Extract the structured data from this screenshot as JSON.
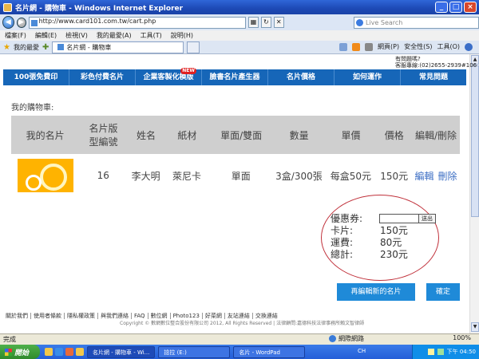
{
  "window": {
    "title": "名片網 - 購物車 - Windows Internet Explorer",
    "controls": [
      "_",
      "□",
      "×"
    ]
  },
  "browser": {
    "url": "http://www.card101.com.tw/cart.php",
    "search_placeholder": "Live Search",
    "menu": [
      "檔案(F)",
      "編輯(E)",
      "檢視(V)",
      "我的最愛(A)",
      "工具(T)",
      "說明(H)"
    ],
    "favorites_label": "我的最愛",
    "tab_label": "名片網 - 購物車",
    "toolbar": [
      "網頁(P)",
      "安全性(S)",
      "工具(O)"
    ]
  },
  "site": {
    "help_line1": "有問題嗎?",
    "help_line2": "客服專線:(02)2655-2939#106",
    "nav": [
      {
        "label": "100張免費印"
      },
      {
        "label": "彩色付費名片"
      },
      {
        "label": "企業客製化模版",
        "badge": "NEW"
      },
      {
        "label": "臉書名片產生器"
      },
      {
        "label": "名片價格"
      },
      {
        "label": "如何運作"
      },
      {
        "label": "常見問題"
      }
    ]
  },
  "cart": {
    "title": "我的購物車:",
    "headers": [
      "我的名片",
      "名片版型編號",
      "姓名",
      "紙材",
      "單面/雙面",
      "數量",
      "單價",
      "價格",
      "編輯/刪除"
    ],
    "row": {
      "template_no": "16",
      "name": "李大明",
      "paper": "萊尼卡",
      "sides": "單面",
      "quantity": "3盒/300張",
      "unit_price": "每盒50元",
      "price": "150元",
      "edit": "編輯",
      "delete": "刪除"
    },
    "summary": {
      "coupon_label": "優惠券:",
      "coupon_button": "送出",
      "card_label": "卡片:",
      "card_value": "150元",
      "shipping_label": "運費:",
      "shipping_value": "80元",
      "total_label": "總計:",
      "total_value": "230元"
    },
    "buttons": {
      "reedit": "再編輯新的名片",
      "confirm": "確定"
    }
  },
  "footer": {
    "links": [
      "關於我們",
      "使用者條款",
      "隱私權政策",
      "與我們連絡",
      "FAQ",
      "數位網",
      "Photo123",
      "好菜網",
      "友站連結",
      "交換連結"
    ],
    "copyright": "Copyright © 數網數位整合股份有限公司 2012, All Rights Reserved | 法律顧問:嘉德科技法律事務所賴文智律師"
  },
  "statusbar": {
    "text": "完成",
    "zone": "網際網路",
    "zoom": "100%"
  },
  "taskbar": {
    "start": "開始",
    "tasks": [
      "名片網 - 購物車 - Wi...",
      "捻拉 (E:)",
      "名片 - WordPad"
    ],
    "lang": "CH",
    "clock": "下午 04:50"
  }
}
